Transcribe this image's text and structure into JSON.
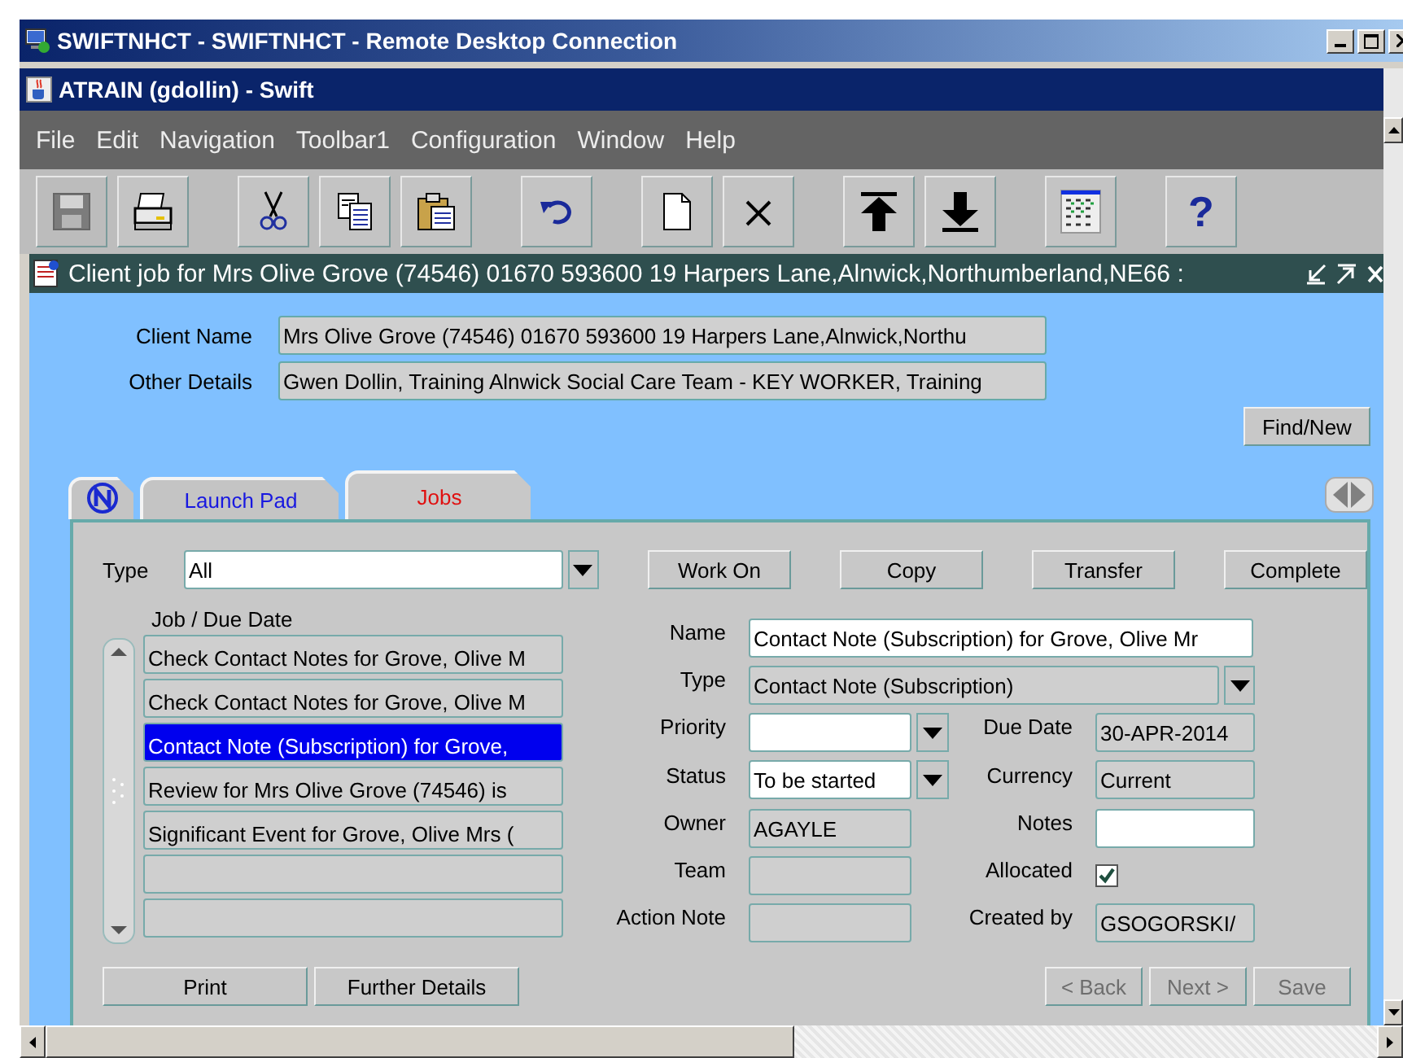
{
  "rdp_window": {
    "title": "SWIFTNHCT - SWIFTNHCT - Remote Desktop Connection"
  },
  "app_window": {
    "title": "ATRAIN (gdollin) - Swift"
  },
  "menu": [
    "File",
    "Edit",
    "Navigation",
    "Toolbar1",
    "Configuration",
    "Window",
    "Help"
  ],
  "toolbar": [
    {
      "kind": "save",
      "disabled": true
    },
    {
      "kind": "print",
      "disabled": false
    },
    {
      "kind": "cut",
      "disabled": false
    },
    {
      "kind": "copy",
      "disabled": false
    },
    {
      "kind": "paste",
      "disabled": false
    },
    {
      "kind": "undo",
      "disabled": false
    },
    {
      "kind": "new",
      "disabled": false
    },
    {
      "kind": "delete",
      "disabled": false
    },
    {
      "kind": "top",
      "disabled": false
    },
    {
      "kind": "bottom",
      "disabled": false
    },
    {
      "kind": "grid",
      "disabled": false
    },
    {
      "kind": "help",
      "label": "?",
      "disabled": false
    }
  ],
  "form_window": {
    "title": "Client job for Mrs Olive Grove (74546) 01670 593600 19 Harpers Lane,Alnwick,Northumberland,NE66 :"
  },
  "header_fields": [
    {
      "label": "Client Name",
      "value": "Mrs Olive Grove (74546) 01670 593600 19 Harpers Lane,Alnwick,Northu"
    },
    {
      "label": "Other Details",
      "value": "Gwen Dollin, Training Alnwick Social Care Team - KEY WORKER, Training"
    }
  ],
  "find_button": "Find/New",
  "tabs": [
    {
      "kind": "logo",
      "selected": false
    },
    {
      "kind": "text",
      "label": "Launch Pad",
      "selected": false
    },
    {
      "kind": "text",
      "label": "Jobs",
      "selected": true
    }
  ],
  "jobs": {
    "type_filter": {
      "label": "Type",
      "value": "All"
    },
    "actions": [
      "Work On",
      "Copy",
      "Transfer",
      "Complete"
    ],
    "list_header": "Job / Due Date",
    "rows": [
      {
        "text": "Check Contact Notes for Grove, Olive M",
        "selected": false
      },
      {
        "text": "Check Contact Notes for Grove, Olive M",
        "selected": false
      },
      {
        "text": "Contact Note (Subscription) for Grove,",
        "selected": true
      },
      {
        "text": "Review for Mrs Olive Grove (74546) is",
        "selected": false
      },
      {
        "text": "Significant Event for Grove, Olive Mrs (",
        "selected": false
      }
    ],
    "details": {
      "name": {
        "label": "Name",
        "value": "Contact Note (Subscription) for Grove, Olive Mr",
        "editable": true
      },
      "type": {
        "label": "Type",
        "value": "Contact Note (Subscription)",
        "editable": false
      },
      "left": [
        {
          "label": "Priority",
          "editable": true,
          "dropdown": true
        },
        {
          "label": "Status",
          "value": "To be started",
          "editable": true,
          "dropdown": true
        },
        {
          "label": "Owner",
          "value": "AGAYLE",
          "editable": false,
          "dropdown": false
        },
        {
          "label": "Team",
          "editable": false,
          "dropdown": false
        },
        {
          "label": "Action Note",
          "editable": false,
          "dropdown": false
        }
      ],
      "right": [
        {
          "kind": "field",
          "label": "Due Date",
          "value": "30-APR-2014",
          "editable": false
        },
        {
          "kind": "field",
          "label": "Currency",
          "value": "Current",
          "editable": false
        },
        {
          "kind": "field",
          "label": "Notes",
          "editable": true
        },
        {
          "kind": "checkbox",
          "label": "Allocated",
          "checked": true
        },
        {
          "kind": "field",
          "label": "Created by",
          "value": "GSOGORSKI/",
          "editable": false
        }
      ]
    },
    "bottom_left": [
      "Print",
      "Further Details"
    ],
    "bottom_right": [
      {
        "label": "< Back",
        "disabled": true
      },
      {
        "label": "Next >",
        "disabled": true
      },
      {
        "label": "Save",
        "disabled": true
      }
    ]
  }
}
